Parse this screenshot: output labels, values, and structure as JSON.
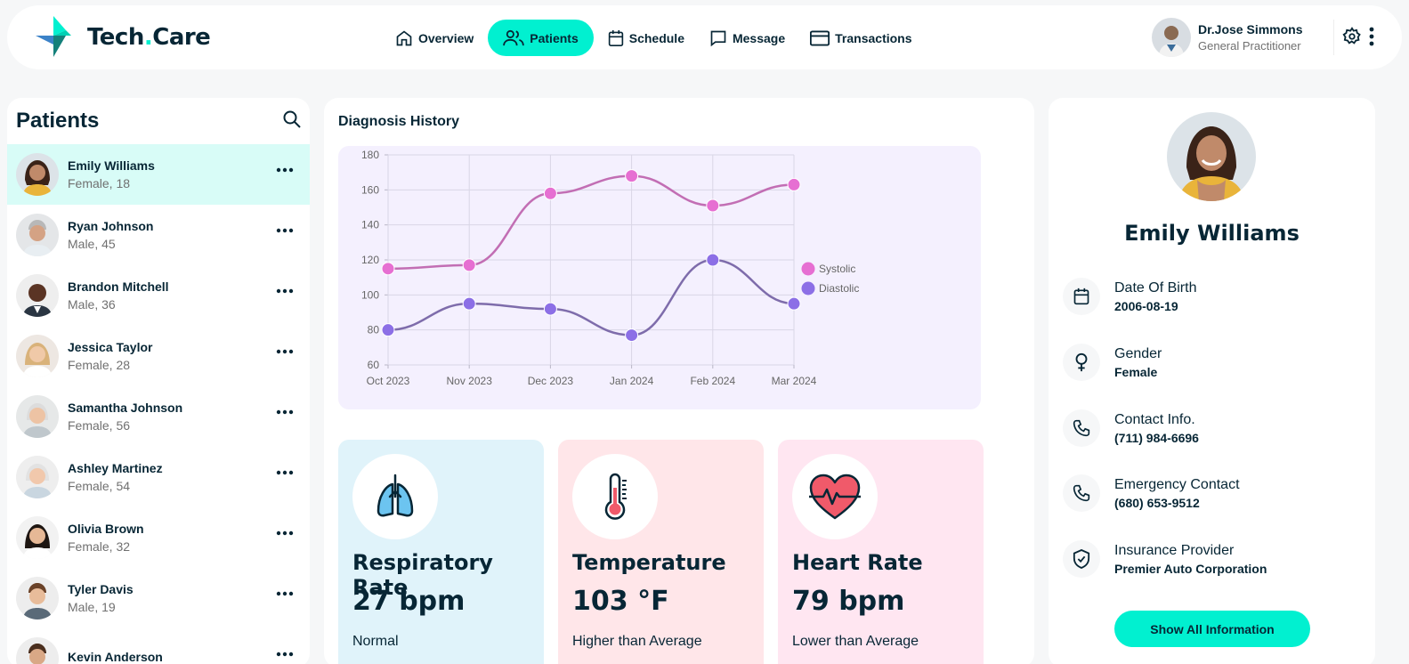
{
  "app": {
    "logo_main": "Tech",
    "logo_dot": ".",
    "logo_end": "Care"
  },
  "nav": [
    {
      "label": "Overview",
      "icon": "home-icon",
      "active": false
    },
    {
      "label": "Patients",
      "icon": "users-icon",
      "active": true
    },
    {
      "label": "Schedule",
      "icon": "calendar-icon",
      "active": false
    },
    {
      "label": "Message",
      "icon": "message-icon",
      "active": false
    },
    {
      "label": "Transactions",
      "icon": "credit-card-icon",
      "active": false
    }
  ],
  "doctor": {
    "name": "Dr.Jose Simmons",
    "role": "General Practitioner"
  },
  "patients": {
    "title": "Patients",
    "list": [
      {
        "name": "Emily Williams",
        "gender": "Female,",
        "age": "18",
        "selected": true
      },
      {
        "name": "Ryan Johnson",
        "gender": "Male,",
        "age": "45"
      },
      {
        "name": "Brandon Mitchell",
        "gender": "Male,",
        "age": "36"
      },
      {
        "name": "Jessica Taylor",
        "gender": "Female,",
        "age": "28"
      },
      {
        "name": "Samantha Johnson",
        "gender": "Female,",
        "age": "56"
      },
      {
        "name": "Ashley Martinez",
        "gender": "Female,",
        "age": "54"
      },
      {
        "name": "Olivia Brown",
        "gender": "Female,",
        "age": "32"
      },
      {
        "name": "Tyler Davis",
        "gender": "Male,",
        "age": "19"
      },
      {
        "name": "Kevin Anderson",
        "gender": "",
        "age": ""
      }
    ]
  },
  "diagnosis": {
    "title": "Diagnosis History"
  },
  "chart_data": {
    "type": "line",
    "x": [
      "Oct 2023",
      "Nov 2023",
      "Dec 2023",
      "Jan 2024",
      "Feb 2024",
      "Mar 2024"
    ],
    "series": [
      {
        "name": "Systolic",
        "color": "#E66FD2",
        "line_color": "#C26EB4",
        "values": [
          115,
          117,
          158,
          168,
          151,
          163
        ]
      },
      {
        "name": "Diastolic",
        "color": "#8C6FE6",
        "line_color": "#7E6CAB",
        "values": [
          80,
          95,
          92,
          77,
          120,
          95
        ]
      }
    ],
    "ylim": [
      60,
      180
    ],
    "yticks": [
      60,
      80,
      100,
      120,
      140,
      160,
      180
    ],
    "legend": "right",
    "grid": true
  },
  "vitals": [
    {
      "label": "Respiratory Rate",
      "value": "27 bpm",
      "status": "Normal",
      "bg": "#E0F3FA",
      "icon": "lungs-icon"
    },
    {
      "label": "Temperature",
      "value": "103 °F",
      "status": "Higher than Average",
      "bg": "#FFE6E9",
      "icon": "thermometer-icon"
    },
    {
      "label": "Heart Rate",
      "value": "79 bpm",
      "status": "Lower than Average",
      "bg": "#FFE6F1",
      "icon": "heart-icon"
    }
  ],
  "profile": {
    "name": "Emily Williams",
    "fields": [
      {
        "label": "Date Of Birth",
        "value": "2006-08-19",
        "icon": "calendar-icon"
      },
      {
        "label": "Gender",
        "value": "Female",
        "icon": "female-icon"
      },
      {
        "label": "Contact Info.",
        "value": "(711) 984-6696",
        "icon": "phone-icon"
      },
      {
        "label": "Emergency Contact",
        "value": "(680) 653-9512",
        "icon": "phone-icon"
      },
      {
        "label": "Insurance Provider",
        "value": "Premier Auto Corporation",
        "icon": "shield-icon"
      }
    ],
    "button": "Show All Information"
  },
  "colors": {
    "accent": "#01F0D0",
    "dark": "#072635",
    "muted": "#707070"
  }
}
